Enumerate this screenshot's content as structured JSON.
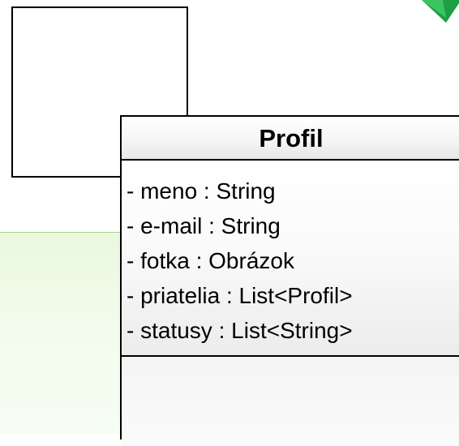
{
  "class_box": {
    "name": "Profil",
    "attributes": [
      "- meno : String",
      "- e-mail : String",
      "- fotka : Obrázok",
      "- priatelia : List<Profil>",
      "- statusy : List<String>"
    ]
  },
  "colors": {
    "green_panel": "#eaf8df",
    "green_border": "#a9d98c",
    "arrow_green": "#22b14c"
  },
  "icons": {
    "corner": "green-arrow-icon"
  }
}
